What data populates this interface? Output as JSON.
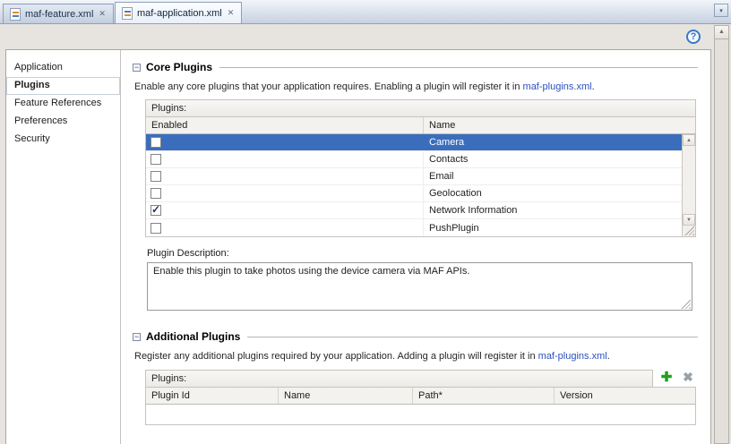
{
  "icons": {
    "close": "✕",
    "help": "?",
    "collapse": "−",
    "check": "✓",
    "plus": "✚",
    "delete": "✖",
    "scroll_up": "▲",
    "scroll_down": "▼",
    "overflow": "▾"
  },
  "colors": {
    "selection_blue": "#3a6ebc",
    "link_blue": "#2a50c0",
    "plus_green": "#1fa01f"
  },
  "tabs": [
    {
      "label": "maf-feature.xml",
      "active": false
    },
    {
      "label": "maf-application.xml",
      "active": true
    }
  ],
  "sidebar": {
    "items": [
      {
        "label": "Application",
        "selected": false
      },
      {
        "label": "Plugins",
        "selected": true
      },
      {
        "label": "Feature References",
        "selected": false
      },
      {
        "label": "Preferences",
        "selected": false
      },
      {
        "label": "Security",
        "selected": false
      }
    ]
  },
  "core_plugins": {
    "title": "Core Plugins",
    "description_prefix": "Enable any core plugins that your application requires. Enabling a plugin will register it in ",
    "description_link": "maf-plugins.xml",
    "description_suffix": ".",
    "table_label": "Plugins:",
    "columns": [
      "Enabled",
      "Name"
    ],
    "rows": [
      {
        "enabled": false,
        "name": "Camera",
        "selected": true
      },
      {
        "enabled": false,
        "name": "Contacts",
        "selected": false
      },
      {
        "enabled": false,
        "name": "Email",
        "selected": false
      },
      {
        "enabled": false,
        "name": "Geolocation",
        "selected": false
      },
      {
        "enabled": true,
        "name": "Network Information",
        "selected": false
      },
      {
        "enabled": false,
        "name": "PushPlugin",
        "selected": false
      }
    ],
    "plugin_description_label": "Plugin Description:",
    "plugin_description": "Enable this plugin to take photos using the device camera via MAF APIs."
  },
  "additional_plugins": {
    "title": "Additional Plugins",
    "description_prefix": "Register any additional plugins required by your application. Adding a plugin will register it in ",
    "description_link": "maf-plugins.xml",
    "description_suffix": ".",
    "table_label": "Plugins:",
    "columns": [
      "Plugin Id",
      "Name",
      "Path*",
      "Version"
    ]
  }
}
